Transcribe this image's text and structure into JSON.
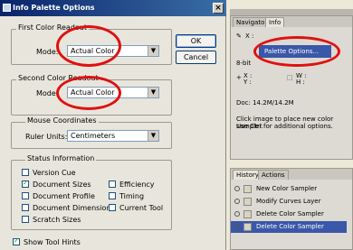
{
  "dialog": {
    "title": "Info Palette Options",
    "close_symbol": "×",
    "ok_label": "OK",
    "cancel_label": "Cancel",
    "first_color_readout": {
      "group_label": "First Color Readout",
      "mode_label": "Mode:",
      "mode_value": "Actual Color"
    },
    "second_color_readout": {
      "group_label": "Second Color Readout",
      "mode_label": "Mode:",
      "mode_value": "Actual Color"
    },
    "mouse_coordinates": {
      "group_label": "Mouse Coordinates",
      "ruler_label": "Ruler Units:",
      "ruler_value": "Centimeters"
    },
    "status_information": {
      "group_label": "Status Information",
      "items": [
        {
          "label": "Version Cue",
          "checked": false
        },
        {
          "label": "Document Sizes",
          "checked": true
        },
        {
          "label": "Document Profile",
          "checked": false
        },
        {
          "label": "Document Dimensions",
          "checked": false
        },
        {
          "label": "Scratch Sizes",
          "checked": false
        },
        {
          "label": "Efficiency",
          "checked": false
        },
        {
          "label": "Timing",
          "checked": false
        },
        {
          "label": "Current Tool",
          "checked": false
        }
      ]
    },
    "show_tool_hints": {
      "label": "Show Tool Hints",
      "checked": true
    }
  },
  "info_panel": {
    "tab_navigator": "Navigator",
    "tab_info": "Info",
    "context_menu_item": "Palette Options...",
    "bit_label": "8-bit",
    "x_label": "X :",
    "y_label": "Y :",
    "w_label": "W :",
    "h_label": "H :",
    "doc_status": "Doc: 14.2M/14.2M",
    "hint_text_1": "Click image to place new color sampler.",
    "hint_text_2": "Use Ctrl for additional options."
  },
  "history_panel": {
    "tab_history": "History",
    "tab_actions": "Actions",
    "items": [
      {
        "label": "New Color Sampler",
        "selected": false
      },
      {
        "label": "Modify Curves Layer",
        "selected": false
      },
      {
        "label": "Delete Color Sampler",
        "selected": false
      },
      {
        "label": "Delete Color Sampler",
        "selected": true
      }
    ]
  },
  "colors": {
    "title_bar": "#0a246a",
    "highlight": "#3a57a8",
    "annotation_red": "#e01010"
  }
}
